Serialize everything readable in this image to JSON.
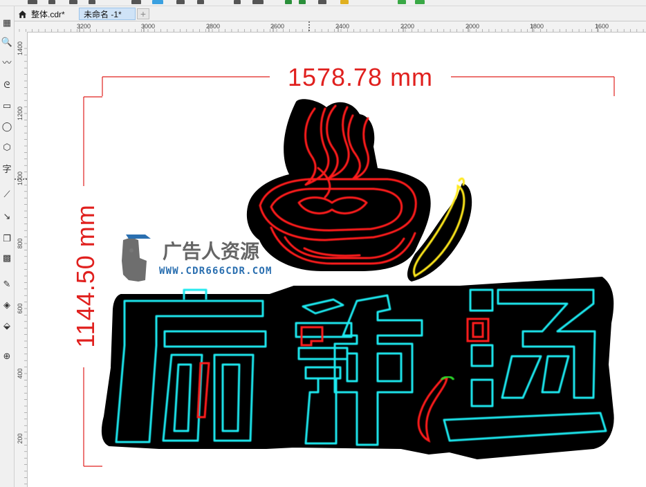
{
  "tabs": [
    {
      "label": "整体.cdr*",
      "active": false
    },
    {
      "label": "未命名 -1*",
      "active": true
    }
  ],
  "add_tab_label": "+",
  "ruler_top_ticks": [
    "3200",
    "3000",
    "2800",
    "2600",
    "2400",
    "2200",
    "2000",
    "1800",
    "1600"
  ],
  "ruler_left_ticks": [
    "1400",
    "1200",
    "1000",
    "800",
    "600",
    "400",
    "200"
  ],
  "tools": [
    {
      "name": "crop-tool-icon",
      "glyph": "▦"
    },
    {
      "name": "zoom-tool-icon",
      "glyph": "🔍"
    },
    {
      "name": "freehand-tool-icon",
      "glyph": "〰"
    },
    {
      "name": "artistic-media-tool-icon",
      "glyph": "ᘓ"
    },
    {
      "name": "rectangle-tool-icon",
      "glyph": "▭"
    },
    {
      "name": "ellipse-tool-icon",
      "glyph": "◯"
    },
    {
      "name": "polygon-tool-icon",
      "glyph": "⬡"
    },
    {
      "name": "text-tool-icon",
      "glyph": "字"
    },
    {
      "name": "dimension-tool-icon",
      "glyph": "⟋"
    },
    {
      "name": "connector-tool-icon",
      "glyph": "↘"
    },
    {
      "name": "drop-shadow-tool-icon",
      "glyph": "❐"
    },
    {
      "name": "transparency-tool-icon",
      "glyph": "▩"
    },
    {
      "name": "eyedropper-tool-icon",
      "glyph": "✎"
    },
    {
      "name": "interactive-fill-tool-icon",
      "glyph": "◈"
    },
    {
      "name": "smart-fill-tool-icon",
      "glyph": "⬙"
    },
    {
      "name": "add-tool-icon",
      "glyph": "⊕"
    }
  ],
  "dimensions": {
    "width": "1578.78 mm",
    "height": "1144.50 mm"
  },
  "watermark": {
    "title": "广告人资源",
    "url": "WWW.CDR666CDR.COM"
  },
  "sign_text": [
    "麻",
    "辣",
    "汤"
  ],
  "colors": {
    "dimension": "#e0201e",
    "neon_cyan": "#1de8ef",
    "neon_red": "#ff1a1a",
    "neon_yellow": "#ffe81a",
    "neon_green": "#2cd92c",
    "backing": "#000000",
    "watermark_blue": "#2a6fb0"
  }
}
